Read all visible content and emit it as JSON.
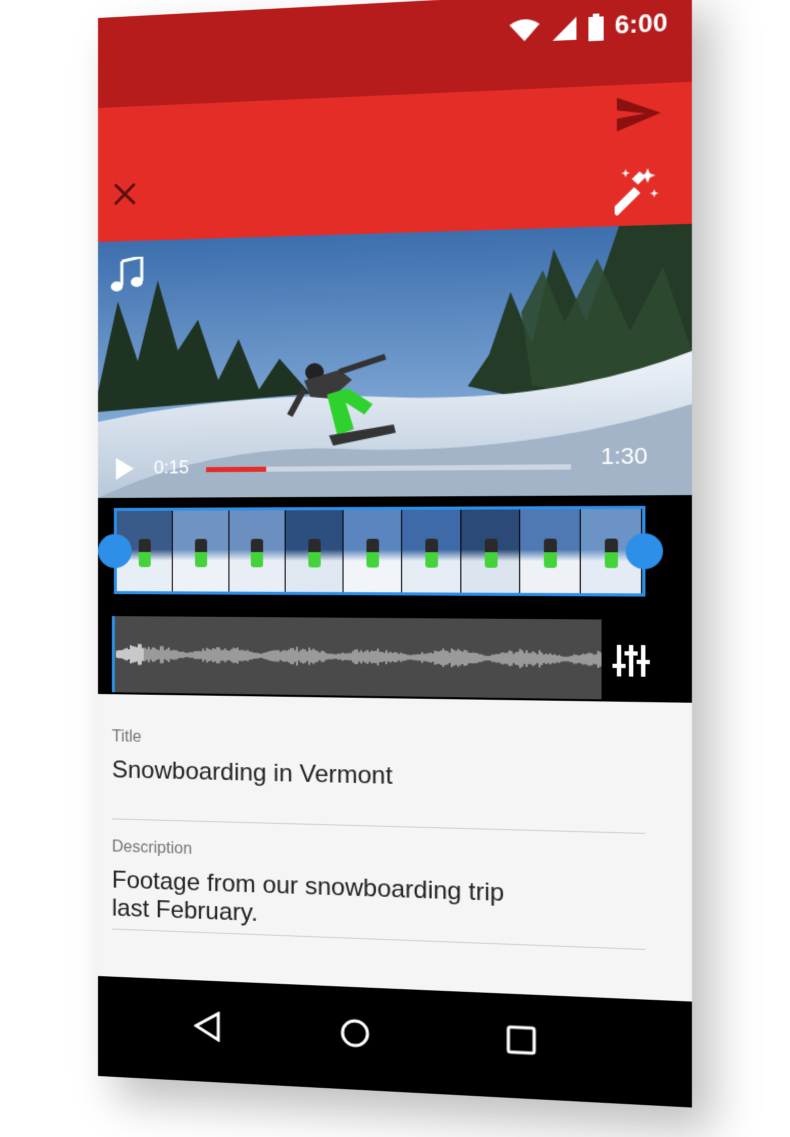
{
  "status_bar": {
    "time": "6:00",
    "icons": [
      "wifi-icon",
      "cell-signal-icon",
      "battery-icon"
    ]
  },
  "app_bar": {
    "actions": [
      "close-icon",
      "send-icon",
      "magic-wand-icon"
    ]
  },
  "video": {
    "current_time": "0:15",
    "total_time": "1:30",
    "progress": 0.17,
    "icons": [
      "music-note-icon",
      "play-icon"
    ]
  },
  "timeline": {
    "frame_count": 9,
    "icons": [
      "equalizer-icon"
    ]
  },
  "form": {
    "title_label": "Title",
    "title_value": "Snowboarding in Vermont",
    "description_label": "Description",
    "description_line1": "Footage from our snowboarding trip",
    "description_line2": "last February."
  },
  "nav_bar": {
    "icons": [
      "back-icon",
      "home-icon",
      "recents-icon"
    ]
  },
  "colors": {
    "status_bar": "#b71c1c",
    "app_bar": "#e52d27",
    "accent_blue": "#2d8fe8",
    "progress_red": "#e52d27"
  }
}
